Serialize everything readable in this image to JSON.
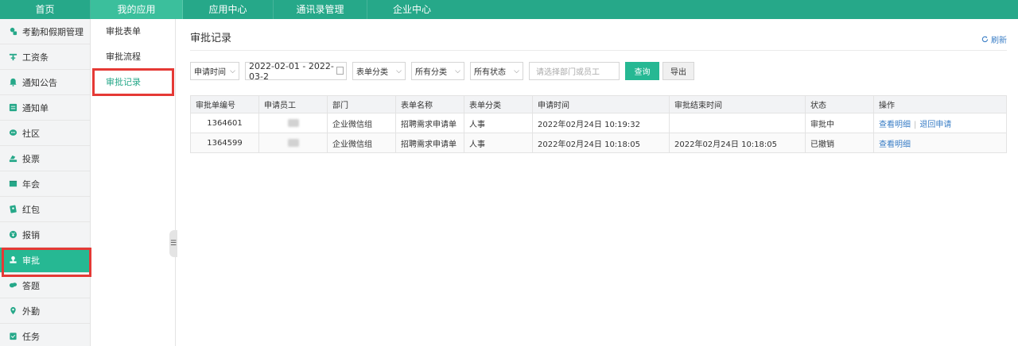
{
  "topnav": {
    "items": [
      {
        "label": "首页"
      },
      {
        "label": "我的应用"
      },
      {
        "label": "应用中心"
      },
      {
        "label": "通讯录管理"
      },
      {
        "label": "企业中心"
      }
    ]
  },
  "sidebar": {
    "items": [
      {
        "label": "考勤和假期管理",
        "icon": "attendance-icon"
      },
      {
        "label": "工资条",
        "icon": "salary-icon"
      },
      {
        "label": "通知公告",
        "icon": "bell-icon"
      },
      {
        "label": "通知单",
        "icon": "notice-list-icon"
      },
      {
        "label": "社区",
        "icon": "chat-icon"
      },
      {
        "label": "投票",
        "icon": "vote-icon"
      },
      {
        "label": "年会",
        "icon": "annual-meeting-icon"
      },
      {
        "label": "红包",
        "icon": "red-packet-icon"
      },
      {
        "label": "报销",
        "icon": "yen-icon"
      },
      {
        "label": "审批",
        "icon": "approval-stamp-icon"
      },
      {
        "label": "答题",
        "icon": "quiz-icon"
      },
      {
        "label": "外勤",
        "icon": "location-pin-icon"
      },
      {
        "label": "任务",
        "icon": "task-icon"
      }
    ]
  },
  "submenu": {
    "items": [
      {
        "label": "审批表单"
      },
      {
        "label": "审批流程"
      },
      {
        "label": "审批记录"
      }
    ]
  },
  "main": {
    "title": "审批记录",
    "refresh_label": "刷新",
    "filters": {
      "time_type": "申请时间",
      "date_range": "2022-02-01 - 2022-03-2",
      "form_category": "表单分类",
      "all_category": "所有分类",
      "all_status": "所有状态",
      "search_placeholder": "请选择部门或员工",
      "query_label": "查询",
      "export_label": "导出"
    },
    "table": {
      "headers": [
        "审批单编号",
        "申请员工",
        "部门",
        "表单名称",
        "表单分类",
        "申请时间",
        "审批结束时间",
        "状态",
        "操作"
      ],
      "rows": [
        {
          "id": "1364601",
          "dept": "企业微信组",
          "form": "招聘需求申请单",
          "category": "人事",
          "apply_time": "2022年02月24日 10:19:32",
          "end_time": "",
          "status": "审批中",
          "action1": "查看明细",
          "action2": "退回申请"
        },
        {
          "id": "1364599",
          "dept": "企业微信组",
          "form": "招聘需求申请单",
          "category": "人事",
          "apply_time": "2022年02月24日 10:18:05",
          "end_time": "2022年02月24日 10:18:05",
          "status": "已撤销",
          "action1": "查看明细",
          "action2": ""
        }
      ]
    }
  },
  "colors": {
    "brand": "#26a889",
    "active": "#26b893",
    "link": "#3a7ec6",
    "highlight": "#e53935"
  }
}
